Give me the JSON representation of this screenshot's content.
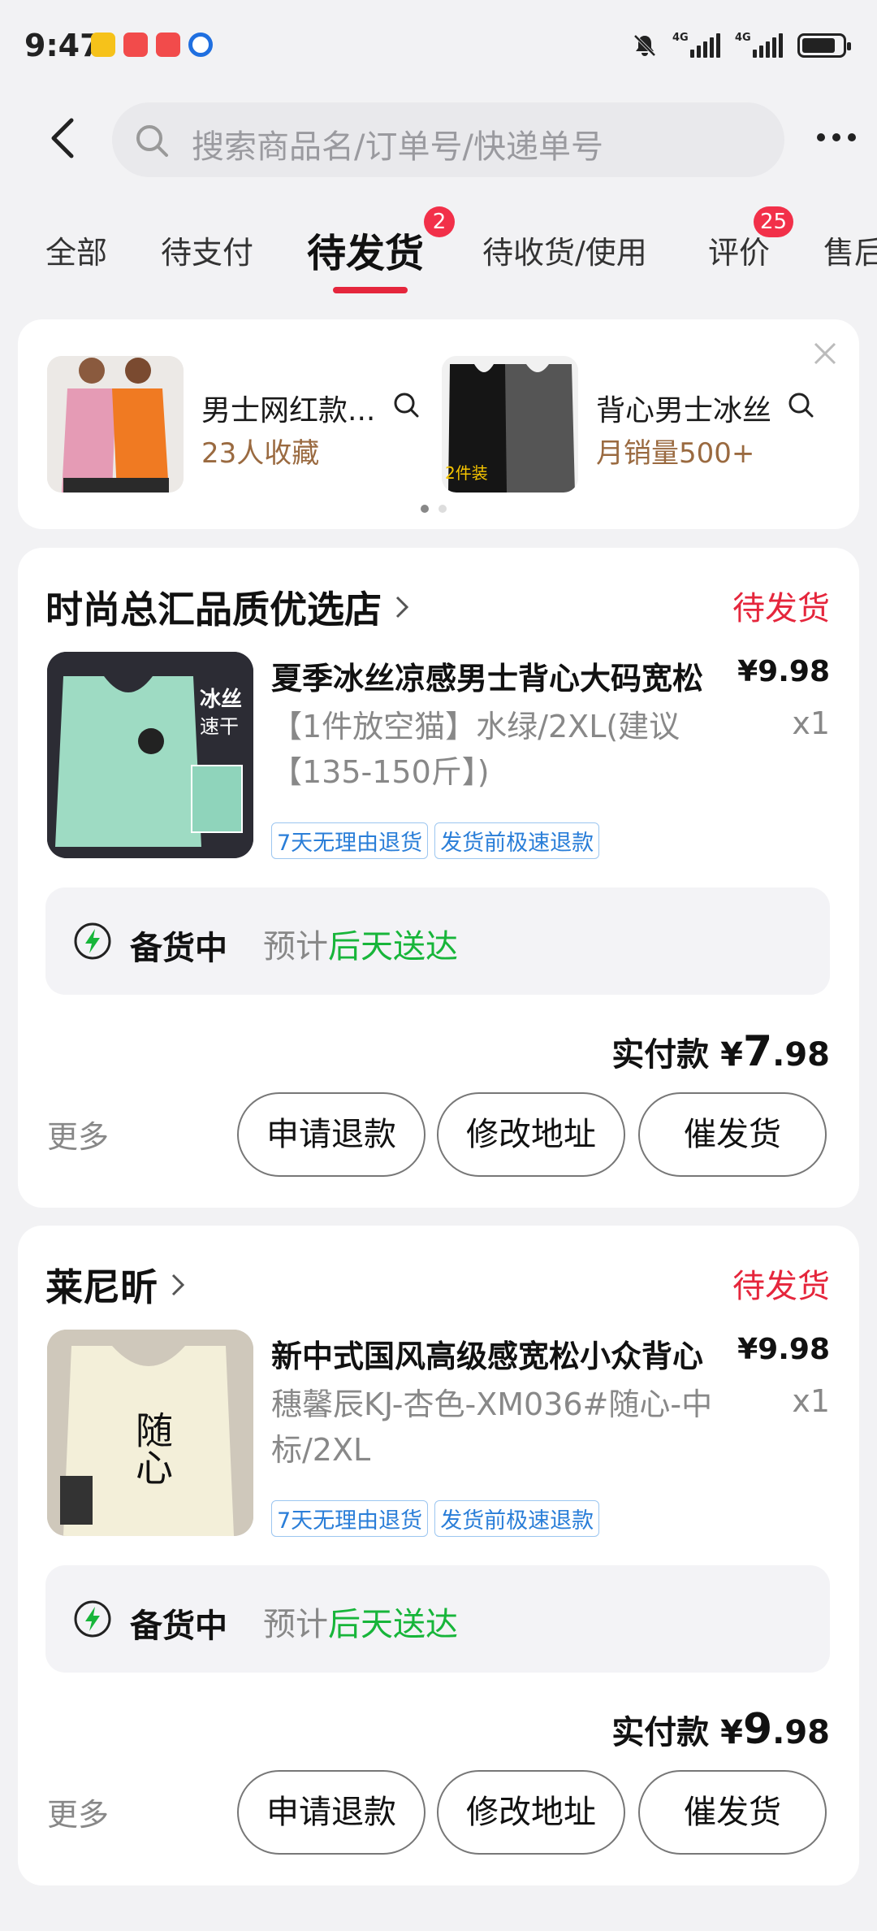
{
  "status_bar": {
    "time": "9:47",
    "net1": "4G",
    "net2": "4G"
  },
  "header": {
    "search_placeholder": "搜索商品名/订单号/快递单号"
  },
  "tabs": [
    {
      "label": "全部"
    },
    {
      "label": "待支付"
    },
    {
      "label": "待发货",
      "badge": "2"
    },
    {
      "label": "待收货/使用"
    },
    {
      "label": "评价",
      "badge": "25"
    },
    {
      "label": "售后"
    }
  ],
  "recommend": {
    "items": [
      {
        "title": "男士网红款...",
        "sub": "23人收藏"
      },
      {
        "title": "背心男士冰丝",
        "sub": "月销量500+",
        "img_caption": "2件装"
      }
    ]
  },
  "orders": [
    {
      "store": "时尚总汇品质优选店",
      "status": "待发货",
      "title": "夏季冰丝凉感男士背心大码宽松",
      "price": "¥9.98",
      "sku": "【1件放空猫】水绿/2XL(建议【135-150斤】)",
      "qty": "x1",
      "img_label1": "冰丝",
      "img_label2": "速干",
      "tags": [
        "7天无理由退货",
        "发货前极速退款"
      ],
      "ship_status": "备货中",
      "ship_est_prefix": "预计",
      "ship_est_day": "后天送达",
      "paid_label": "实付款 ¥",
      "paid_int": "7",
      "paid_dec": ".98",
      "more": "更多",
      "buttons": [
        "申请退款",
        "修改地址",
        "催发货"
      ]
    },
    {
      "store": "莱尼昕",
      "status": "待发货",
      "title": "新中式国风高级感宽松小众背心",
      "price": "¥9.98",
      "sku": "穗馨辰KJ-杏色-XM036#随心-中标/2XL",
      "qty": "x1",
      "img_label1": "随心",
      "tags": [
        "7天无理由退货",
        "发货前极速退款"
      ],
      "ship_status": "备货中",
      "ship_est_prefix": "预计",
      "ship_est_day": "后天送达",
      "paid_label": "实付款 ¥",
      "paid_int": "9",
      "paid_dec": ".98",
      "more": "更多",
      "buttons": [
        "申请退款",
        "修改地址",
        "催发货"
      ]
    }
  ],
  "colors": {
    "accent": "#e5263c",
    "green": "#17b53a",
    "tag_blue": "#2a7ed8"
  }
}
